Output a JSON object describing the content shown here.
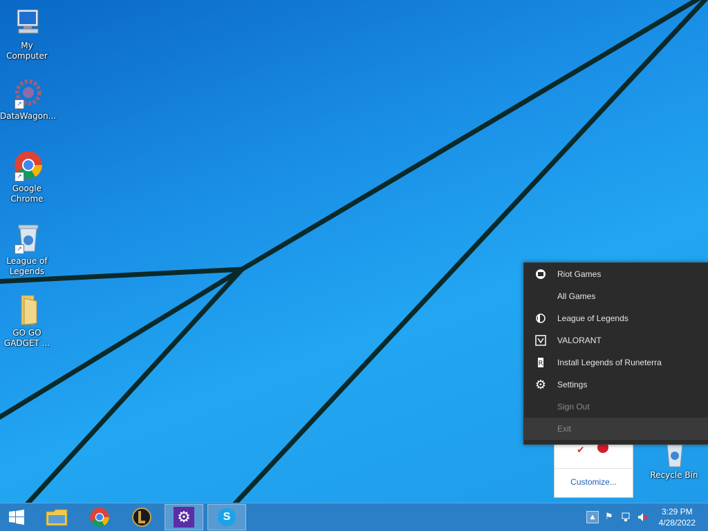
{
  "desktop": {
    "icons": [
      {
        "label": "My Computer"
      },
      {
        "label": "DataWagon..."
      },
      {
        "label": "Google\nChrome"
      },
      {
        "label": "League of\nLegends"
      },
      {
        "label": "GO GO\nGADGET ..."
      },
      {
        "label": "Recycle Bin"
      }
    ]
  },
  "tray_popup": {
    "customize_label": "Customize..."
  },
  "context_menu": {
    "items": [
      {
        "label": "Riot Games",
        "icon": "riot-icon",
        "enabled": true
      },
      {
        "label": "All Games",
        "icon": "",
        "enabled": true
      },
      {
        "label": "League of Legends",
        "icon": "league-icon",
        "enabled": true
      },
      {
        "label": "VALORANT",
        "icon": "valorant-icon",
        "enabled": true
      },
      {
        "label": "Install Legends of Runeterra",
        "icon": "runeterra-icon",
        "enabled": true
      },
      {
        "label": "Settings",
        "icon": "gear-icon",
        "enabled": true
      },
      {
        "label": "Sign Out",
        "icon": "",
        "enabled": false
      },
      {
        "label": "Exit",
        "icon": "",
        "enabled": false
      }
    ]
  },
  "taskbar": {
    "apps": [
      {
        "name": "start-button"
      },
      {
        "name": "file-explorer"
      },
      {
        "name": "chrome"
      },
      {
        "name": "league-of-legends"
      },
      {
        "name": "settings",
        "active": true
      },
      {
        "name": "skype",
        "active": true
      }
    ],
    "clock": {
      "time": "3:29 PM",
      "date": "4/28/2022"
    }
  },
  "colors": {
    "menu_bg": "#2b2b2b",
    "taskbar": "#2a7fc6",
    "wallpaper": "#1a8fe6"
  }
}
